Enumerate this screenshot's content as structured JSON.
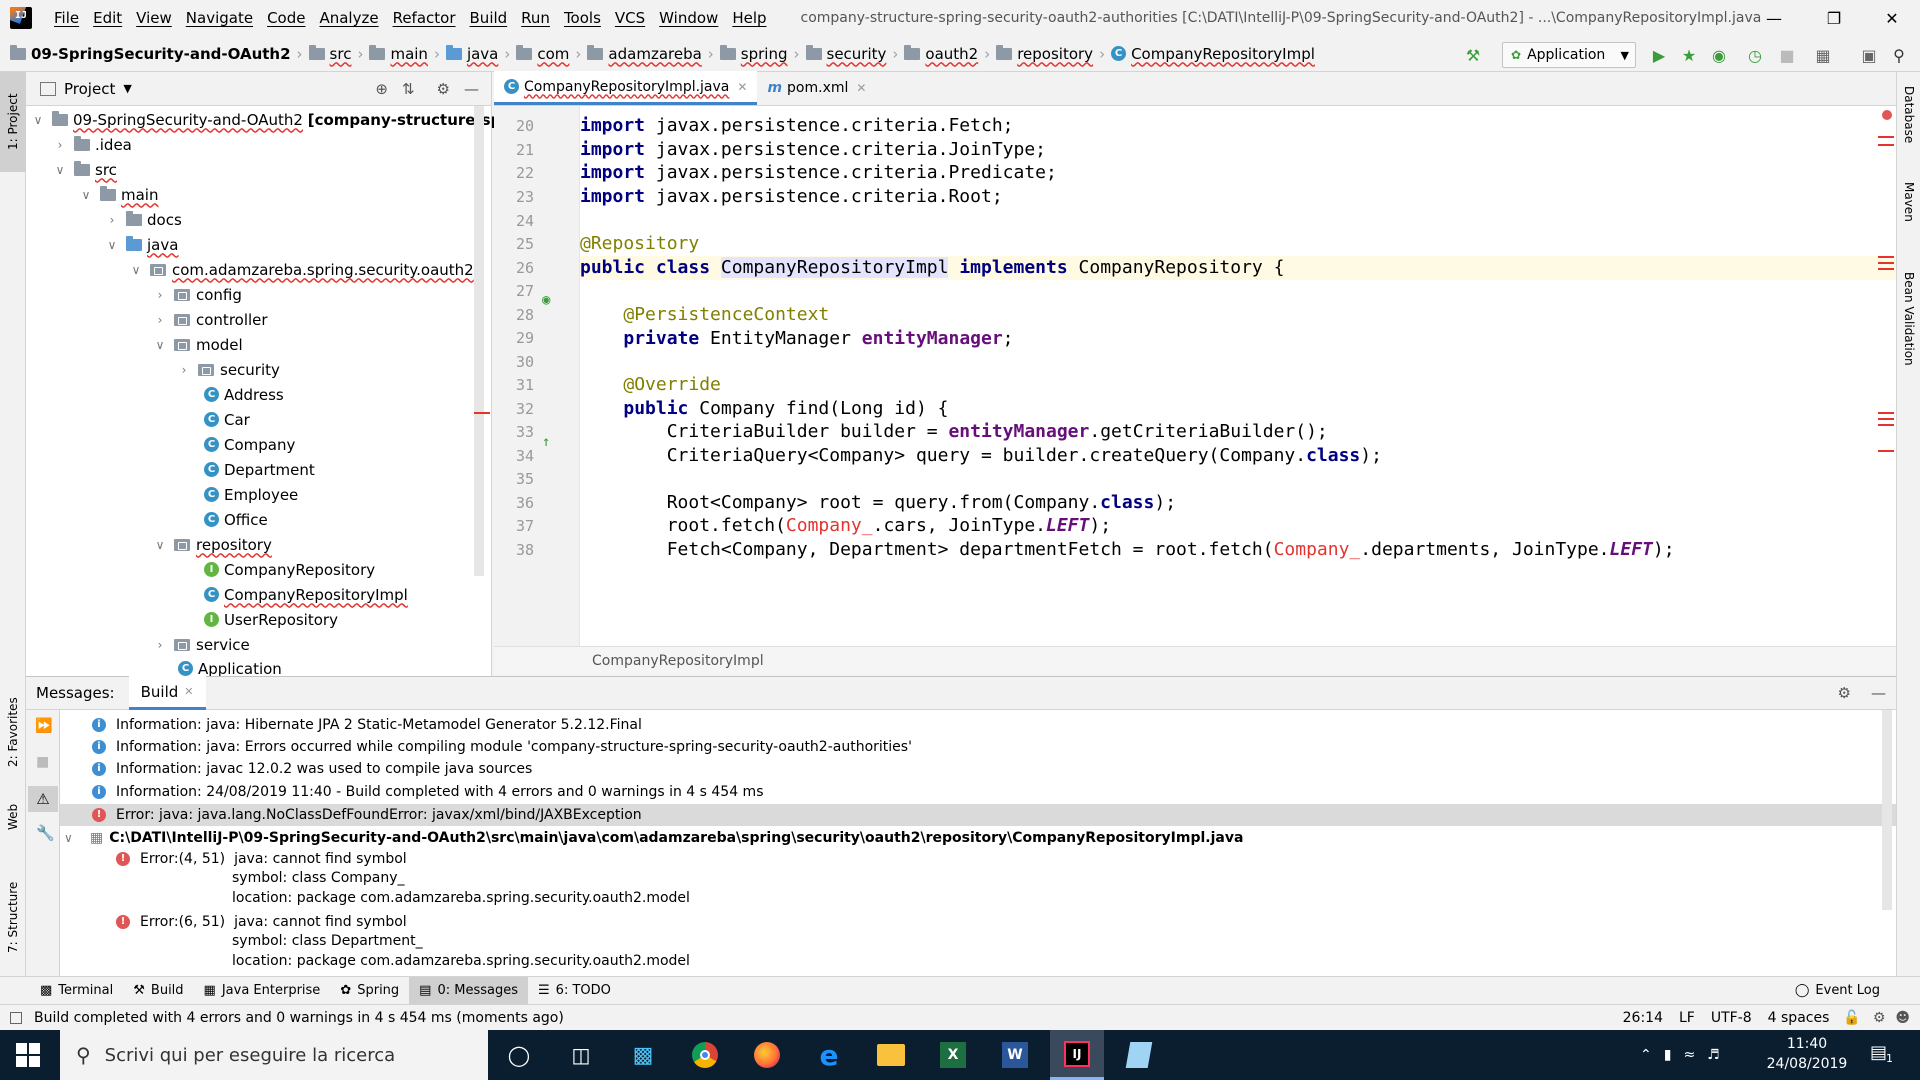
{
  "menu": {
    "items": [
      "File",
      "Edit",
      "View",
      "Navigate",
      "Code",
      "Analyze",
      "Refactor",
      "Build",
      "Run",
      "Tools",
      "VCS",
      "Window",
      "Help"
    ],
    "window_title": "company-structure-spring-security-oauth2-authorities [C:\\DATI\\IntelliJ-P\\09-SpringSecurity-and-OAuth2] - ...\\CompanyRepositoryImpl.java"
  },
  "navbar": {
    "crumbs": [
      "09-SpringSecurity-and-OAuth2",
      "src",
      "main",
      "java",
      "com",
      "adamzareba",
      "spring",
      "security",
      "oauth2",
      "repository",
      "CompanyRepositoryImpl"
    ],
    "run_config": "Application"
  },
  "project": {
    "title": "Project",
    "nodes": [
      {
        "label": "09-SpringSecurity-and-OAuth2",
        "extra": "[company-structure-spring-se"
      },
      {
        "label": ".idea"
      },
      {
        "label": "src"
      },
      {
        "label": "main"
      },
      {
        "label": "docs"
      },
      {
        "label": "java"
      },
      {
        "label": "com.adamzareba.spring.security.oauth2"
      },
      {
        "label": "config"
      },
      {
        "label": "controller"
      },
      {
        "label": "model"
      },
      {
        "label": "security"
      },
      {
        "label": "Address"
      },
      {
        "label": "Car"
      },
      {
        "label": "Company"
      },
      {
        "label": "Department"
      },
      {
        "label": "Employee"
      },
      {
        "label": "Office"
      },
      {
        "label": "repository"
      },
      {
        "label": "CompanyRepository"
      },
      {
        "label": "CompanyRepositoryImpl"
      },
      {
        "label": "UserRepository"
      },
      {
        "label": "service"
      },
      {
        "label": "Application"
      }
    ]
  },
  "editor": {
    "tabs": [
      "CompanyRepositoryImpl.java",
      "pom.xml"
    ],
    "line_numbers": [
      "20",
      "21",
      "22",
      "23",
      "24",
      "25",
      "26",
      "27",
      "28",
      "29",
      "30",
      "31",
      "32",
      "33",
      "34",
      "35",
      "36",
      "37",
      "38"
    ],
    "breadcrumb": "CompanyRepositoryImpl"
  },
  "messages": {
    "label": "Messages:",
    "tab": "Build",
    "rows": [
      {
        "type": "info",
        "text": "Information: java: Hibernate JPA 2 Static-Metamodel Generator 5.2.12.Final"
      },
      {
        "type": "info",
        "text": "Information: java: Errors occurred while compiling module 'company-structure-spring-security-oauth2-authorities'"
      },
      {
        "type": "info",
        "text": "Information: javac 12.0.2 was used to compile java sources"
      },
      {
        "type": "info",
        "text": "Information: 24/08/2019 11:40 - Build completed with 4 errors and 0 warnings in 4 s 454 ms"
      },
      {
        "type": "error",
        "text": "Error: java: java.lang.NoClassDefFoundError: javax/xml/bind/JAXBException"
      }
    ],
    "file_path": "C:\\DATI\\IntelliJ-P\\09-SpringSecurity-and-OAuth2\\src\\main\\java\\com\\adamzareba\\spring\\security\\oauth2\\repository\\CompanyRepositoryImpl.java",
    "errors": [
      {
        "pos": "Error:(4, 51)",
        "msg": "java: cannot find symbol",
        "symbol": "symbol:   class Company_",
        "location": "location: package com.adamzareba.spring.security.oauth2.model"
      },
      {
        "pos": "Error:(6, 51)",
        "msg": "java: cannot find symbol",
        "symbol": "symbol:   class Department_",
        "location": "location: package com.adamzareba.spring.security.oauth2.model"
      }
    ]
  },
  "tooltabs": {
    "items": [
      "Terminal",
      "Build",
      "Java Enterprise",
      "Spring",
      "0: Messages",
      "6: TODO"
    ],
    "event_log": "Event Log"
  },
  "status": {
    "message": "Build completed with 4 errors and 0 warnings in 4 s 454 ms (moments ago)",
    "position": "26:14",
    "line_sep": "LF",
    "encoding": "UTF-8",
    "indent": "4 spaces"
  },
  "side_tabs": {
    "left": [
      "1: Project",
      "2: Favorites",
      "Web",
      "7: Structure"
    ],
    "right": [
      "Database",
      "Maven",
      "Bean Validation"
    ]
  },
  "taskbar": {
    "search_placeholder": "Scrivi qui per eseguire la ricerca",
    "time": "11:40",
    "date": "24/08/2019",
    "notifications": "1"
  }
}
